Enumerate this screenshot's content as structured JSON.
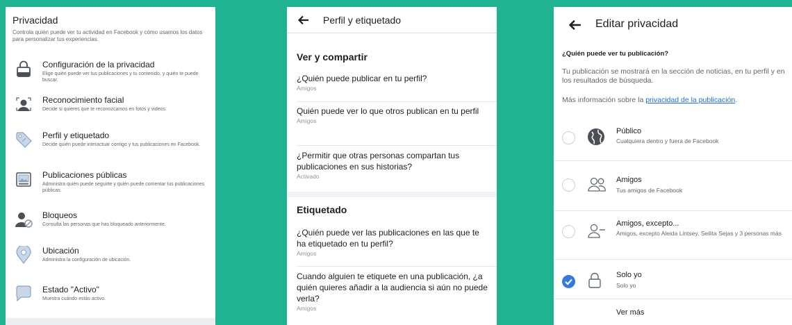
{
  "panel1": {
    "title": "Privacidad",
    "description": "Controla quién puede ver tu actividad en Facebook y cómo usamos los datos para personalizar tus experiencias.",
    "items": [
      {
        "label": "Configuración de la privacidad",
        "sub": "Elige quién puede ver tus publicaciones y tu contenido, y quién te puede buscar.",
        "icon": "lock-icon"
      },
      {
        "label": "Reconocimiento facial",
        "sub": "Decide si quieres que te reconozcamos en fotos y videos.",
        "icon": "face-recognition-icon"
      },
      {
        "label": "Perfil y etiquetado",
        "sub": "Decide quién puede interactuar contigo y tus publicaciones en Facebook.",
        "icon": "tag-icon"
      },
      {
        "label": "Publicaciones públicas",
        "sub": "Administra quién puede seguirte y quién puede comentar tus publicaciones públicas.",
        "icon": "public-post-icon"
      },
      {
        "label": "Bloqueos",
        "sub": "Consulta las personas que has bloqueado anteriormente.",
        "icon": "blocked-user-icon"
      },
      {
        "label": "Ubicación",
        "sub": "Administra la configuración de ubicación.",
        "icon": "location-pin-icon"
      },
      {
        "label": "Estado \"Activo\"",
        "sub": "Muestra cuándo estás activo.",
        "icon": "chat-bubble-icon"
      }
    ]
  },
  "panel2": {
    "title": "Perfil y etiquetado",
    "sections": [
      {
        "heading": "Ver y compartir",
        "items": [
          {
            "question": "¿Quién puede publicar en tu perfil?",
            "value": "Amigos"
          },
          {
            "question": "Quién puede ver lo que otros publican en tu perfil",
            "value": "Amigos"
          },
          {
            "question": "¿Permitir que otras personas compartan tus publicaciones en sus historias?",
            "value": "Activado"
          }
        ]
      },
      {
        "heading": "Etiquetado",
        "items": [
          {
            "question": "¿Quién puede ver las publicaciones en las que te ha etiquetado en tu perfil?",
            "value": "Amigos"
          },
          {
            "question": "Cuando alguien te etiquete en una publicación, ¿a quién quieres añadir a la audiencia si aún no puede verla?",
            "value": "Amigos"
          }
        ]
      }
    ]
  },
  "panel3": {
    "title": "Editar privacidad",
    "question": "¿Quién puede ver tu publicación?",
    "info": "Tu publicación se mostrará en la sección de noticias, en tu perfil y en los resultados de búsqueda.",
    "more_prefix": "Más información sobre la ",
    "more_link": "privacidad de la publicación",
    "more_suffix": ".",
    "options": [
      {
        "label": "Público",
        "sub": "Cualquiera dentro y fuera de Facebook",
        "icon": "globe-icon",
        "selected": false
      },
      {
        "label": "Amigos",
        "sub": "Tus amigos de Facebook",
        "icon": "friends-icon",
        "selected": false
      },
      {
        "label": "Amigos, excepto...",
        "sub": "Amigos, excepto Aleida Lintsey, Seilita Sejas y 3 personas más",
        "icon": "friends-except-icon",
        "selected": false
      },
      {
        "label": "Solo yo",
        "sub": "Solo yo",
        "icon": "lock-icon",
        "selected": true
      }
    ],
    "see_more": "Ver más"
  },
  "colors": {
    "background": "#1fb391",
    "link": "#216fdb",
    "selected": "#3578e5"
  }
}
